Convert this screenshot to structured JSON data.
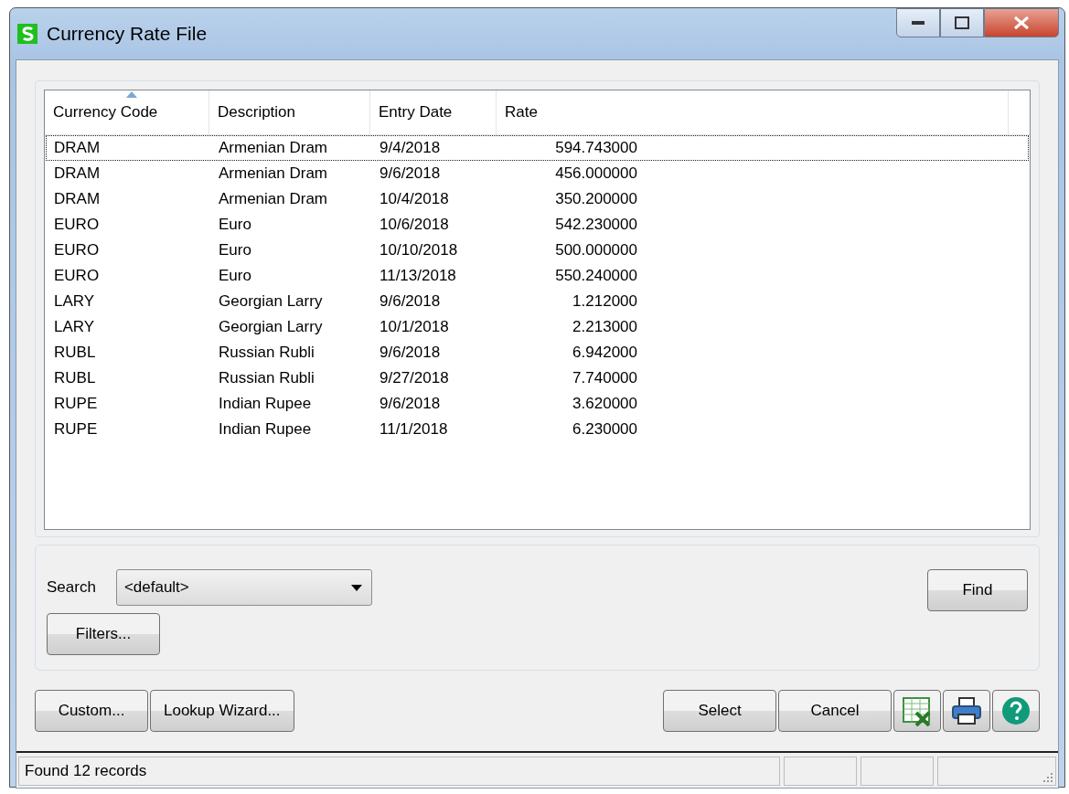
{
  "window": {
    "title": "Currency Rate File"
  },
  "table": {
    "columns": [
      {
        "label": "Currency Code",
        "sorted": true
      },
      {
        "label": "Description",
        "sorted": false
      },
      {
        "label": "Entry Date",
        "sorted": false
      },
      {
        "label": "Rate",
        "sorted": false
      }
    ],
    "rows": [
      {
        "focused": true,
        "cells": [
          "DRAM",
          "Armenian Dram",
          "9/4/2018",
          "594.743000"
        ]
      },
      {
        "focused": false,
        "cells": [
          "DRAM",
          "Armenian Dram",
          "9/6/2018",
          "456.000000"
        ]
      },
      {
        "focused": false,
        "cells": [
          "DRAM",
          "Armenian Dram",
          "10/4/2018",
          "350.200000"
        ]
      },
      {
        "focused": false,
        "cells": [
          "EURO",
          "Euro",
          "10/6/2018",
          "542.230000"
        ]
      },
      {
        "focused": false,
        "cells": [
          "EURO",
          "Euro",
          "10/10/2018",
          "500.000000"
        ]
      },
      {
        "focused": false,
        "cells": [
          "EURO",
          "Euro",
          "11/13/2018",
          "550.240000"
        ]
      },
      {
        "focused": false,
        "cells": [
          "LARY",
          "Georgian Larry",
          "9/6/2018",
          "1.212000"
        ]
      },
      {
        "focused": false,
        "cells": [
          "LARY",
          "Georgian Larry",
          "10/1/2018",
          "2.213000"
        ]
      },
      {
        "focused": false,
        "cells": [
          "RUBL",
          "Russian Rubli",
          "9/6/2018",
          "6.942000"
        ]
      },
      {
        "focused": false,
        "cells": [
          "RUBL",
          "Russian Rubli",
          "9/27/2018",
          "7.740000"
        ]
      },
      {
        "focused": false,
        "cells": [
          "RUPE",
          "Indian Rupee",
          "9/6/2018",
          "3.620000"
        ]
      },
      {
        "focused": false,
        "cells": [
          "RUPE",
          "Indian Rupee",
          "11/1/2018",
          "6.230000"
        ]
      }
    ]
  },
  "search": {
    "label": "Search",
    "value": "<default>",
    "filters_button": "Filters...",
    "find_button": "Find"
  },
  "buttons_left": [
    "Custom...",
    "Lookup Wizard..."
  ],
  "buttons_right": [
    "Select",
    "Cancel"
  ],
  "icon_buttons": [
    {
      "kind": "excel"
    },
    {
      "kind": "print"
    },
    {
      "kind": "help"
    }
  ],
  "status_bar": {
    "text": "Found 12 records"
  }
}
